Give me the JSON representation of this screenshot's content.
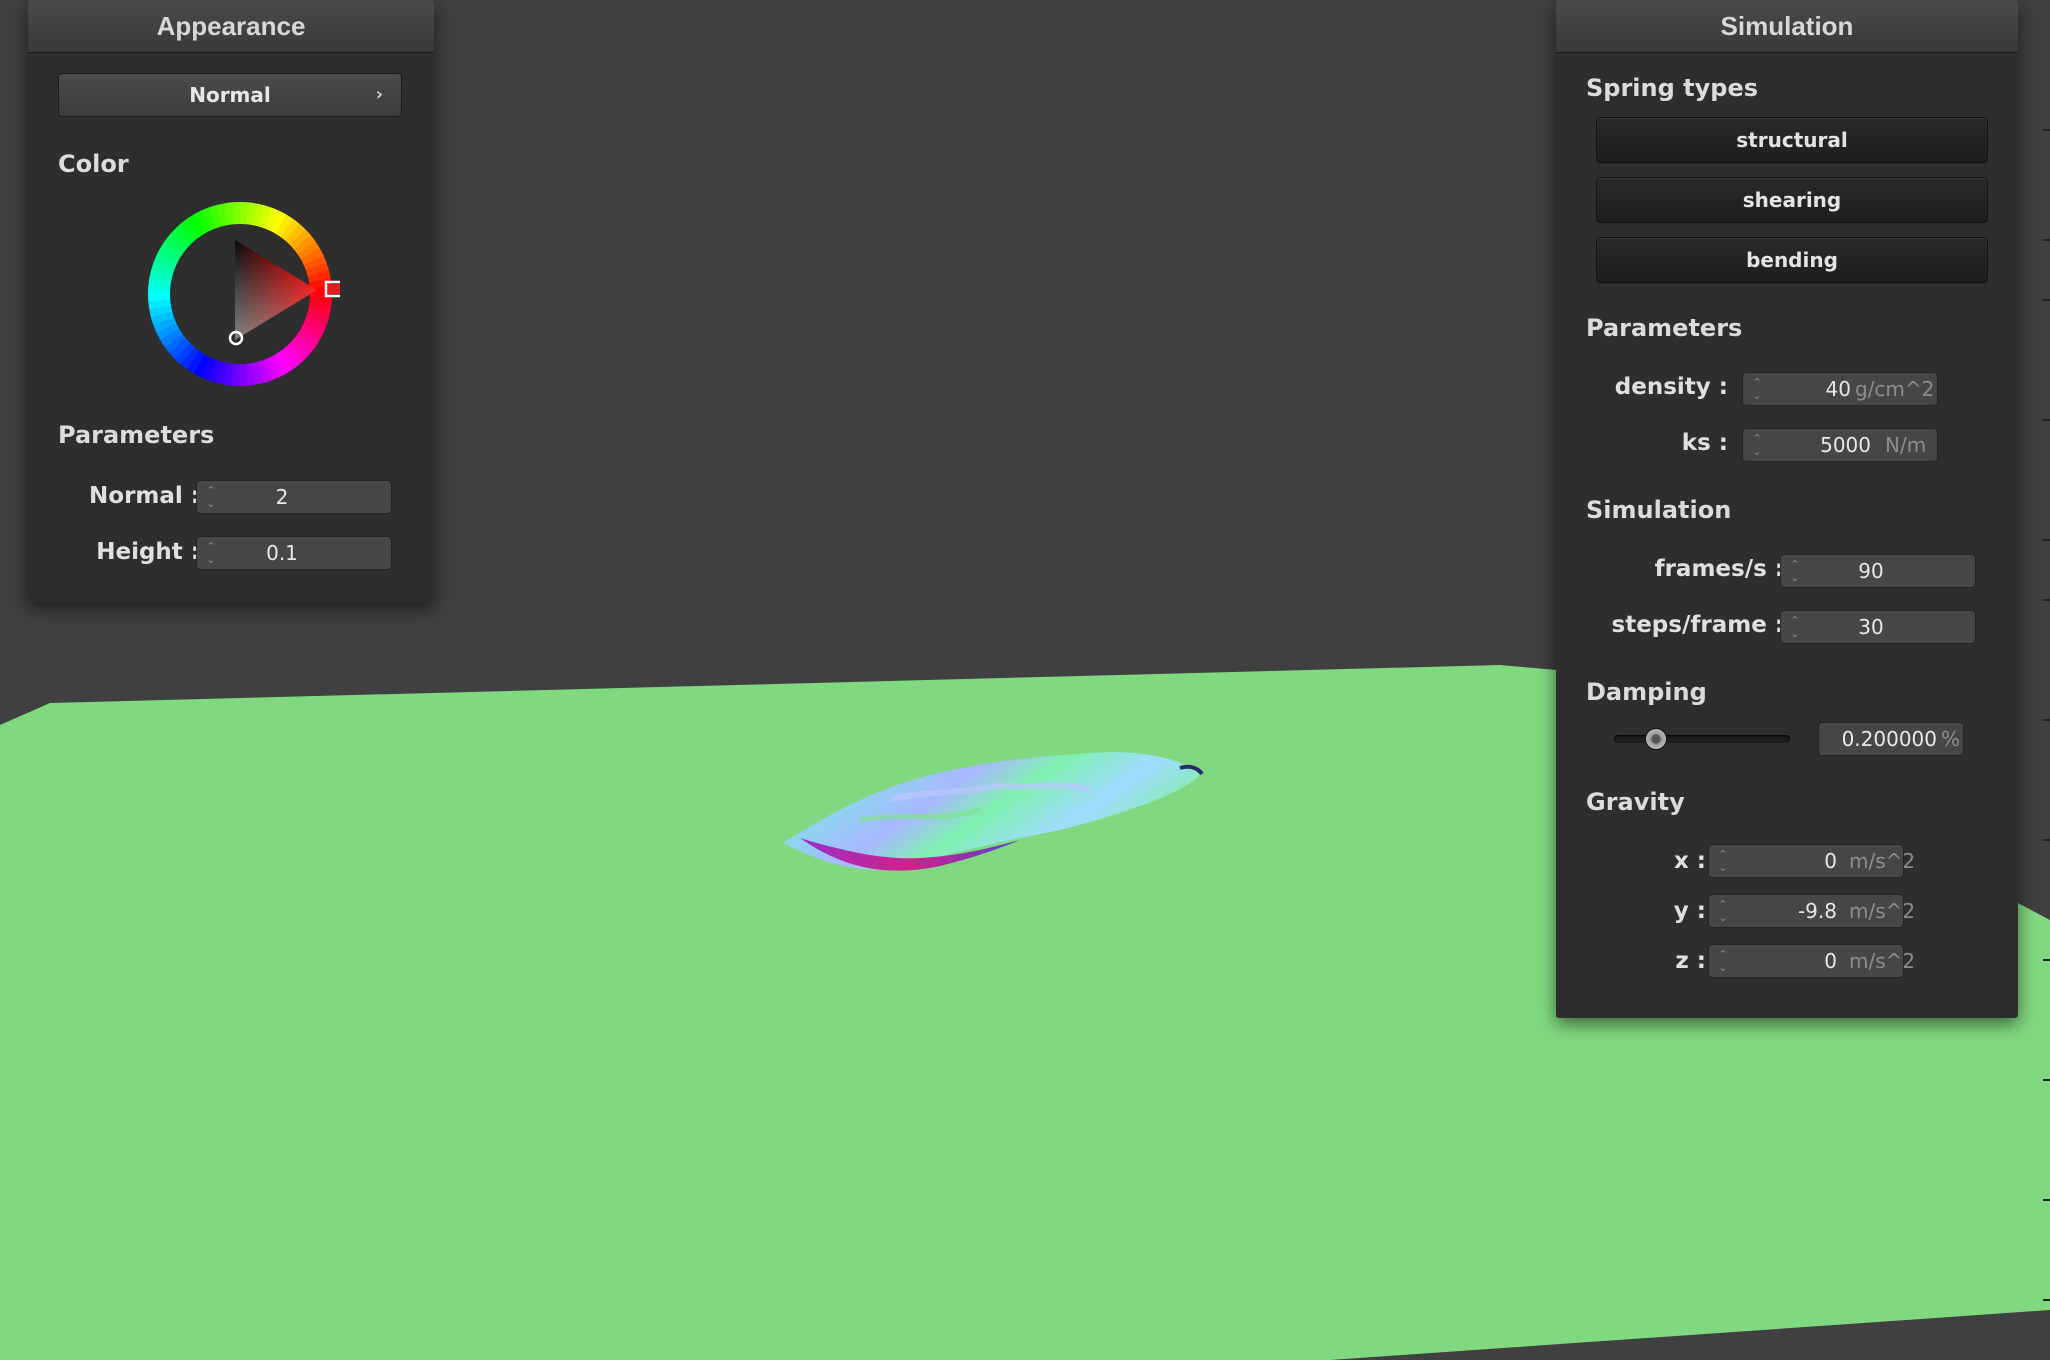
{
  "appearance": {
    "title": "Appearance",
    "shader_select": "Normal",
    "color_label": "Color",
    "params_heading": "Parameters",
    "normal_label": "Normal :",
    "normal_value": "2",
    "height_label": "Height :",
    "height_value": "0.1",
    "selected_color": "#ff0000"
  },
  "simulation": {
    "title": "Simulation",
    "spring_heading": "Spring types",
    "springs": [
      "structural",
      "shearing",
      "bending"
    ],
    "params_heading": "Parameters",
    "density_label": "density :",
    "density_value": "40",
    "density_unit": "g/cm^2",
    "ks_label": "ks :",
    "ks_value": "5000",
    "ks_unit": "N/m",
    "sim_heading": "Simulation",
    "fps_label": "frames/s :",
    "fps_value": "90",
    "steps_label": "steps/frame :",
    "steps_value": "30",
    "damping_heading": "Damping",
    "damping_value": "0.200000",
    "damping_unit": "%",
    "damping_slider_fraction": 0.2,
    "gravity_heading": "Gravity",
    "gx_label": "x :",
    "gx_value": "0",
    "gy_label": "y :",
    "gy_value": "-9.8",
    "gz_label": "z :",
    "gz_value": "0",
    "gravity_unit": "m/s^2"
  },
  "scene": {
    "background_color": "#404040",
    "floor_color": "#80d980"
  }
}
